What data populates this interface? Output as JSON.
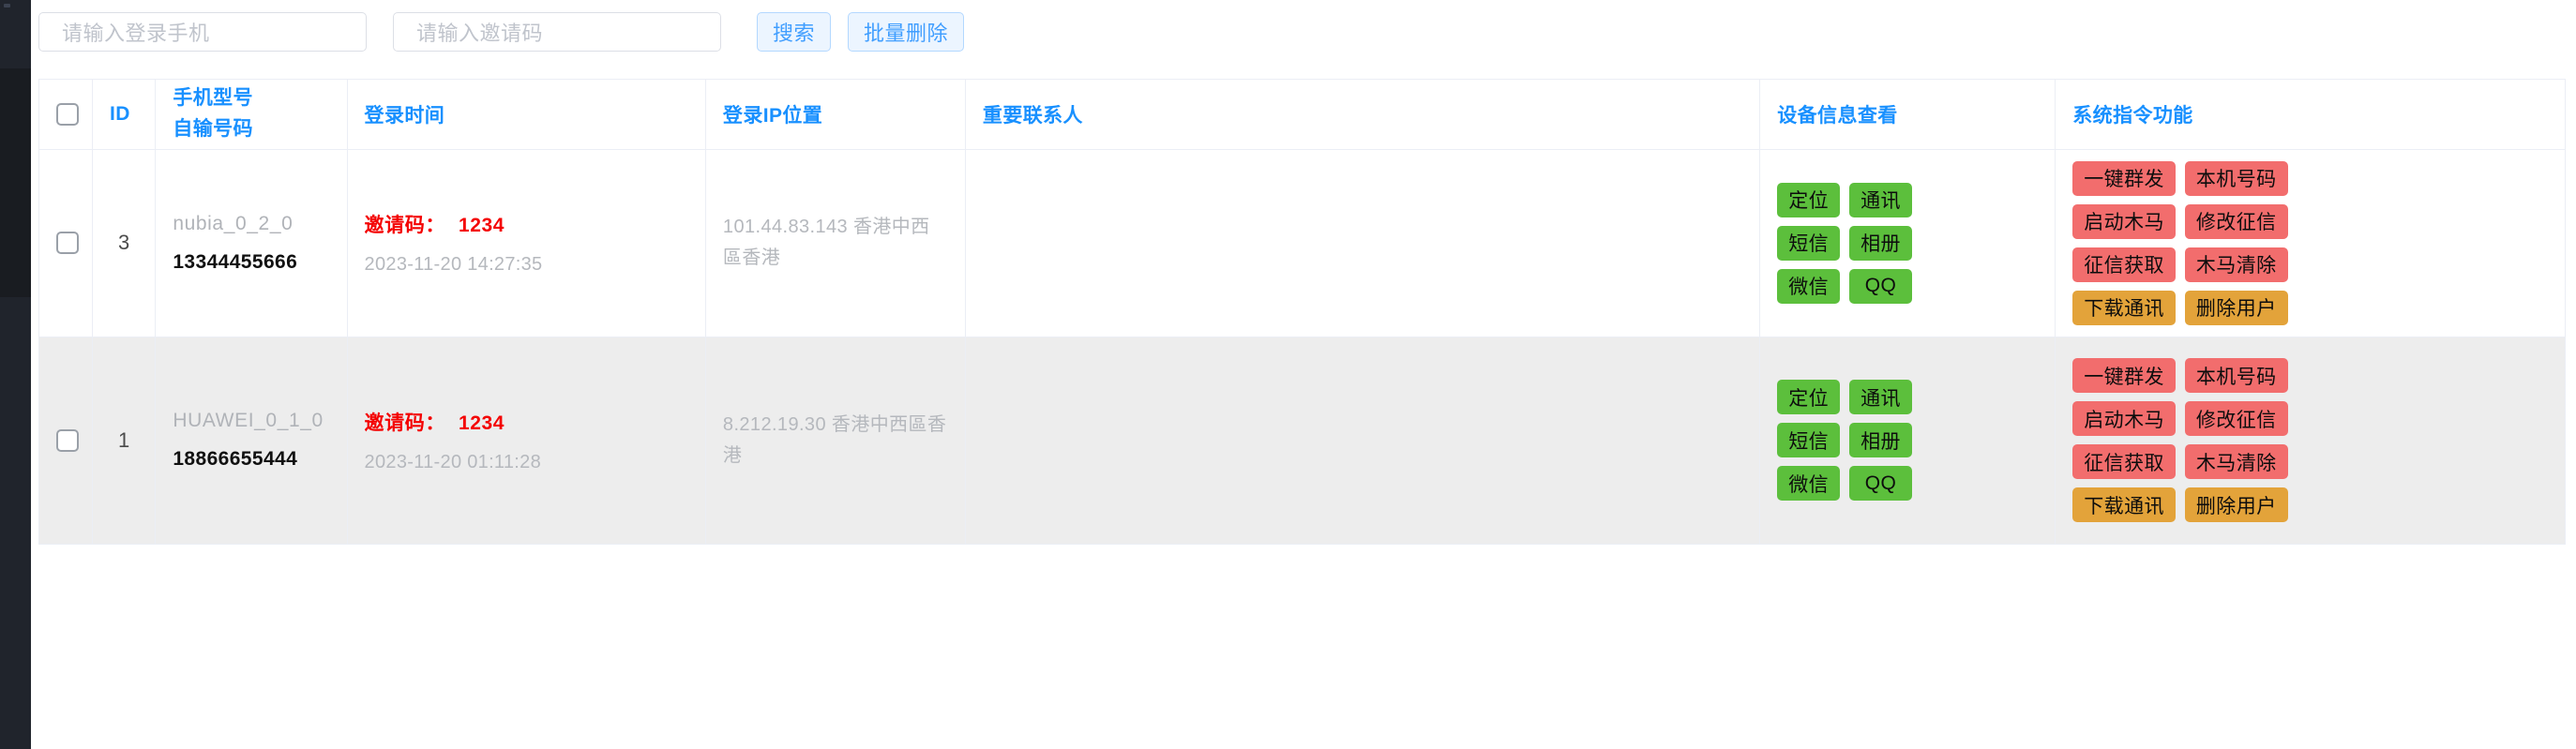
{
  "toolbar": {
    "phone_input": {
      "value": "",
      "placeholder": "请输入登录手机"
    },
    "invite_input": {
      "value": "",
      "placeholder": "请输入邀请码"
    },
    "search_label": "搜索",
    "batch_delete_label": "批量删除"
  },
  "table": {
    "headers": {
      "checkbox": "",
      "id": "ID",
      "model_line1": "手机型号",
      "model_line2": "自输号码",
      "login_time": "登录时间",
      "login_ip": "登录IP位置",
      "important_contact": "重要联系人",
      "device_info": "设备信息查看",
      "system_commands": "系统指令功能"
    },
    "rows": [
      {
        "id": "3",
        "model": "nubia_0_2_0",
        "number": "13344455666",
        "invite_label": "邀请码：",
        "invite_code": "1234",
        "login_time": "2023-11-20 14:27:35",
        "login_ip": "101.44.83.143 香港中西區香港",
        "important_contact": "",
        "device_buttons": [
          {
            "label": "定位",
            "color": "green"
          },
          {
            "label": "通讯",
            "color": "green"
          },
          {
            "label": "短信",
            "color": "green"
          },
          {
            "label": "相册",
            "color": "green"
          },
          {
            "label": "微信",
            "color": "green"
          },
          {
            "label": "QQ",
            "color": "green"
          }
        ],
        "system_buttons": [
          {
            "label": "一键群发",
            "color": "red"
          },
          {
            "label": "本机号码",
            "color": "red"
          },
          {
            "label": "启动木马",
            "color": "red"
          },
          {
            "label": "修改征信",
            "color": "red"
          },
          {
            "label": "征信获取",
            "color": "red"
          },
          {
            "label": "木马清除",
            "color": "red"
          },
          {
            "label": "下载通讯",
            "color": "orange"
          },
          {
            "label": "删除用户",
            "color": "orange"
          }
        ]
      },
      {
        "id": "1",
        "model": "HUAWEI_0_1_0",
        "number": "18866655444",
        "invite_label": "邀请码：",
        "invite_code": "1234",
        "login_time": "2023-11-20 01:11:28",
        "login_ip": "8.212.19.30 香港中西區香港",
        "important_contact": "",
        "device_buttons": [
          {
            "label": "定位",
            "color": "green"
          },
          {
            "label": "通讯",
            "color": "green"
          },
          {
            "label": "短信",
            "color": "green"
          },
          {
            "label": "相册",
            "color": "green"
          },
          {
            "label": "微信",
            "color": "green"
          },
          {
            "label": "QQ",
            "color": "green"
          }
        ],
        "system_buttons": [
          {
            "label": "一键群发",
            "color": "red"
          },
          {
            "label": "本机号码",
            "color": "red"
          },
          {
            "label": "启动木马",
            "color": "red"
          },
          {
            "label": "修改征信",
            "color": "red"
          },
          {
            "label": "征信获取",
            "color": "red"
          },
          {
            "label": "木马清除",
            "color": "red"
          },
          {
            "label": "下载通讯",
            "color": "orange"
          },
          {
            "label": "删除用户",
            "color": "orange"
          }
        ]
      }
    ]
  },
  "colors": {
    "header_blue": "#1890ff",
    "invite_red": "#f40000",
    "green_button": "#5cbf3c",
    "red_button": "#f26d6d",
    "orange_button": "#e3a33a",
    "sidebar_dark": "#20242c",
    "row_alt_grey": "#ededed"
  }
}
